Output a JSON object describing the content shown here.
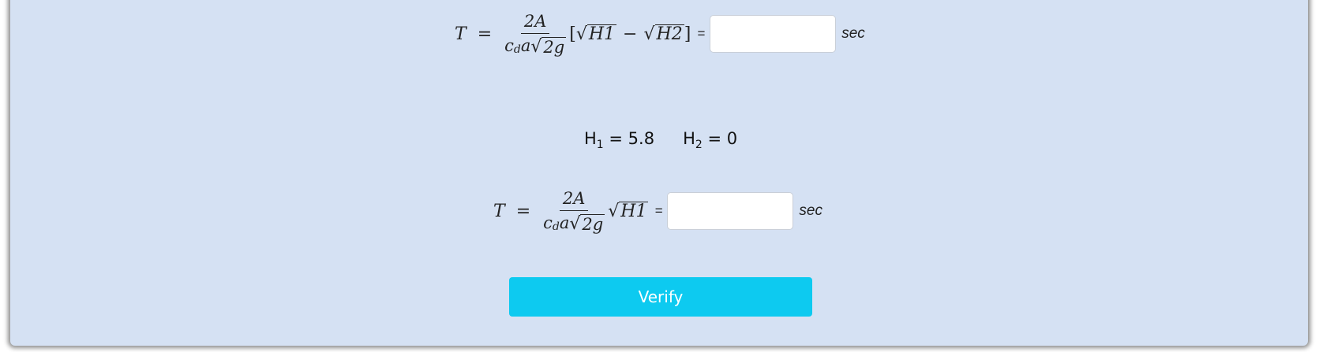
{
  "formula1": {
    "lhs_var": "T",
    "eq_sign": "=",
    "numerator": "2A",
    "den_c": "c",
    "den_c_sub": "d",
    "den_a": "a",
    "den_sqrt_arg": "2g",
    "open_bracket": "[",
    "term1": "H1",
    "minus": "−",
    "term2": "H2",
    "close_bracket": "]",
    "equals": "=",
    "input_value": "",
    "unit": "sec"
  },
  "params": {
    "h1_label": "H",
    "h1_sub": "1",
    "h1_value": " = 5.8",
    "h2_label": "H",
    "h2_sub": "2",
    "h2_value": " = 0"
  },
  "formula2": {
    "lhs_var": "T",
    "eq_sign": "=",
    "numerator": "2A",
    "den_c": "c",
    "den_c_sub": "d",
    "den_a": "a",
    "den_sqrt_arg": "2g",
    "term1": "H1",
    "equals": "=",
    "input_value": "",
    "unit": "sec"
  },
  "verify_button": {
    "label": "Verify",
    "color": "#0dcaf0"
  },
  "panel_color": "#d5e1f3"
}
